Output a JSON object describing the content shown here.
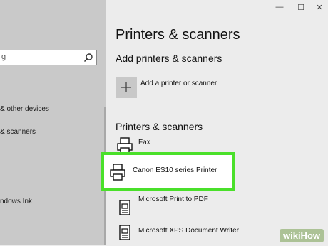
{
  "sidebar": {
    "search_placeholder": "g",
    "items": [
      {
        "label": "& other devices"
      },
      {
        "label": "& scanners"
      },
      {
        "label": "ndows Ink"
      }
    ]
  },
  "window": {
    "minimize": "—",
    "maximize": "☐",
    "close": "✕"
  },
  "main": {
    "title": "Printers & scanners",
    "add_section_heading": "Add printers & scanners",
    "add_button_label": "Add a printer or scanner",
    "list_heading": "Printers & scanners",
    "printers": [
      {
        "label": "Fax"
      },
      {
        "label": "Canon ES10 series Printer"
      },
      {
        "label": "Microsoft Print to PDF"
      },
      {
        "label": "Microsoft XPS Document Writer"
      }
    ]
  },
  "watermark": "wikiHow",
  "colors": {
    "highlight": "#4ae02a",
    "sidebar_bg": "#c9c9c9",
    "main_bg": "#ececec"
  }
}
